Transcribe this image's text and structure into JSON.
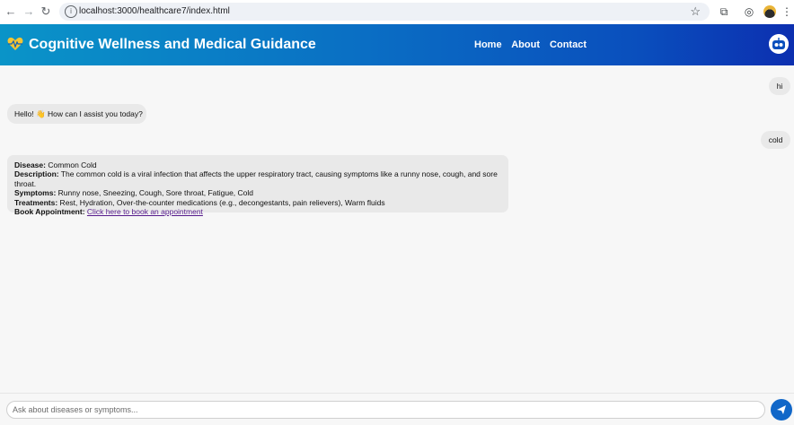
{
  "browser": {
    "url": "localhost:3000/healthcare7/index.html"
  },
  "header": {
    "title": "Cognitive Wellness and Medical Guidance",
    "nav": [
      "Home",
      "About",
      "Contact"
    ]
  },
  "chat": {
    "messages": [
      {
        "sender": "user",
        "text": "hi"
      },
      {
        "sender": "bot",
        "text": "Hello! 👋 How can I assist you today?"
      },
      {
        "sender": "user",
        "text": "cold"
      }
    ],
    "disease_card": {
      "disease_label": "Disease:",
      "disease": " Common Cold",
      "description_label": "Description:",
      "description": " The common cold is a viral infection that affects the upper respiratory tract, causing symptoms like a runny nose, cough, and sore throat.",
      "symptoms_label": "Symptoms:",
      "symptoms": " Runny nose, Sneezing, Cough, Sore throat, Fatigue, Cold",
      "treatments_label": "Treatments:",
      "treatments": " Rest, Hydration, Over-the-counter medications (e.g., decongestants, pain relievers), Warm fluids",
      "appointment_label": "Book Appointment:",
      "appointment_link": "Click here to book an appointment"
    }
  },
  "input": {
    "placeholder": "Ask about diseases or symptoms..."
  },
  "colors": {
    "header_start": "#0a94c8",
    "header_end": "#0c2fb0",
    "send_button": "#1167c8",
    "bubble": "#e9e9e9"
  }
}
